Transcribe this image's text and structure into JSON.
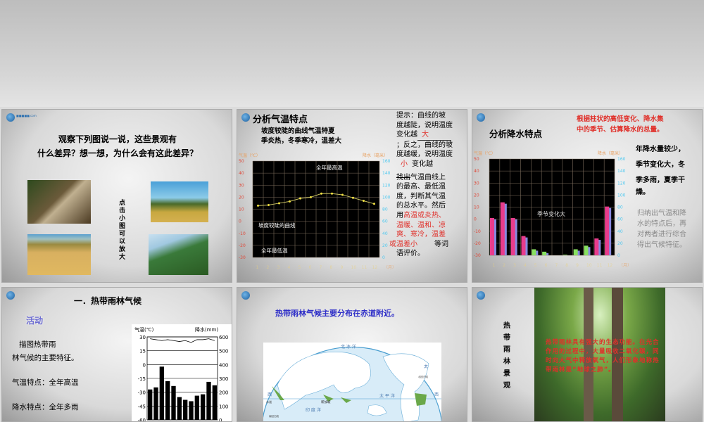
{
  "slides": [
    {
      "title_l1": "观察下列图说一说，这些景观有",
      "title_l2": "什么差异？想一想，为什么会有这此差异？",
      "hint": "点击小图可以放大"
    },
    {
      "title": "分析气温特点",
      "sub_l1": "坡度较陡的曲线气温特夏",
      "sub_l2": "季炎热，冬季寒冷，温差大",
      "tip": [
        "提示：曲线的坡",
        "度越陡，说明温度",
        "变化越",
        "；反之，曲线的坡",
        "度越缓，说明温度",
        "变化越"
      ],
      "fill1": "大",
      "fill2": "小",
      "find": "找出",
      "para": [
        "气温曲线上",
        "的最高、最低温",
        "度，判断其气温",
        "的总水平。然后",
        "用"
      ],
      "red": [
        "高温或炎热、",
        "温暖、温和、凉",
        "爽、寒冷，温差",
        "或温差小"
      ],
      "para_end": "等词",
      "para_end2": "语评价。",
      "chart_labels": {
        "max": "全年最高温",
        "curve": "坡度较陡的曲线",
        "min": "全年最低温"
      }
    },
    {
      "title": "分析降水特点",
      "instr_l1": "根据柱状的高低变化、降水集",
      "instr_l2": "中的季节、估算降水的总量。",
      "result": [
        "年降水量较少，",
        "季节变化大，冬",
        "季多雨，夏季干",
        "燥。"
      ],
      "summary": [
        "归纳出气温和降",
        "水的特点后，再",
        "对两者进行综合",
        "得出气候特征。"
      ],
      "chart_label": "季节变化大"
    },
    {
      "title": "一．热带雨林气候",
      "activity": "活动",
      "q_l1": "描图热带雨",
      "q_l2": "林气候的主要特征。",
      "temp": "气温特点：全年高温",
      "precip": "降水特点：全年多雨"
    },
    {
      "title": "热带雨林气候主要分布在赤道附近。",
      "map": {
        "ocean1": "北 冰 洋",
        "ocean2": "太 平 洋",
        "ocean3": "印 度 洋",
        "equator": "赤道",
        "west": "西",
        "west2": "西",
        "sg": "新加坡",
        "tropic_n": "北回归线",
        "tropic_s": "南回归线",
        "tai": "太"
      }
    },
    {
      "vertical_title": "热带雨林景观",
      "overlay": "热带雨林具有强大的生态功能。在光合作用的过程中，大量吸收二氧化碳，同时向大气中释放氧气，人们形象地称热带雨林是“地球之肺”。"
    }
  ],
  "chart_data": [
    {
      "type": "line",
      "title": "气温曲线",
      "ylabel": "气温（℃）",
      "y2label": "降水（毫米）",
      "xlabel": "（月）",
      "categories": [
        "1",
        "2",
        "3",
        "4",
        "5",
        "6",
        "7",
        "8",
        "9",
        "10",
        "11",
        "12"
      ],
      "values": [
        13,
        13.5,
        15,
        16.5,
        19,
        20,
        23,
        23,
        22,
        19.5,
        17,
        14.5
      ],
      "yticks": [
        50,
        40,
        30,
        20,
        10,
        0,
        -10,
        -20,
        -30
      ],
      "y2ticks": [
        160,
        140,
        120,
        100,
        80,
        60,
        40,
        20,
        0
      ],
      "ylim": [
        -30,
        50
      ],
      "y2lim": [
        0,
        160
      ]
    },
    {
      "type": "bar",
      "title": "降水柱状图",
      "ylabel": "气温（℃）",
      "y2label": "降水（毫米）",
      "xlabel": "（月）",
      "categories": [
        "1",
        "2",
        "3",
        "4",
        "5",
        "6",
        "7",
        "8",
        "9",
        "10",
        "11",
        "12"
      ],
      "values": [
        62,
        88,
        62,
        32,
        10,
        6,
        0,
        1,
        10,
        16,
        28,
        81
      ],
      "yticks": [
        50,
        40,
        30,
        20,
        10,
        0,
        -10,
        -20,
        -30
      ],
      "y2ticks": [
        160,
        140,
        120,
        100,
        80,
        60,
        40,
        20,
        0
      ],
      "ylim": [
        -30,
        50
      ],
      "y2lim": [
        0,
        160
      ]
    },
    {
      "type": "bar",
      "title": "热带雨林气候",
      "ylabel": "气温(℃)",
      "y2label": "降水(mm)",
      "categories": [
        "1",
        "2",
        "3",
        "4",
        "5",
        "6",
        "7",
        "8",
        "9",
        "10",
        "11",
        "12"
      ],
      "values": [
        220,
        235,
        385,
        280,
        245,
        165,
        145,
        135,
        175,
        185,
        275,
        250
      ],
      "temp": [
        28,
        27,
        26,
        27,
        26,
        25,
        26,
        24,
        27,
        27,
        28,
        26
      ],
      "yticks": [
        30,
        15,
        0,
        -15,
        -30,
        -45,
        -60
      ],
      "y2ticks": [
        600,
        500,
        400,
        300,
        200,
        100,
        0
      ],
      "ylim": [
        -60,
        30
      ],
      "y2lim": [
        0,
        600
      ]
    }
  ],
  "colors": {
    "red": "#e0302a",
    "blue": "#3030c8",
    "orange": "#e8a060",
    "cyan": "#4cc8f0",
    "pink": "#e83c8c",
    "green": "#88e060"
  }
}
